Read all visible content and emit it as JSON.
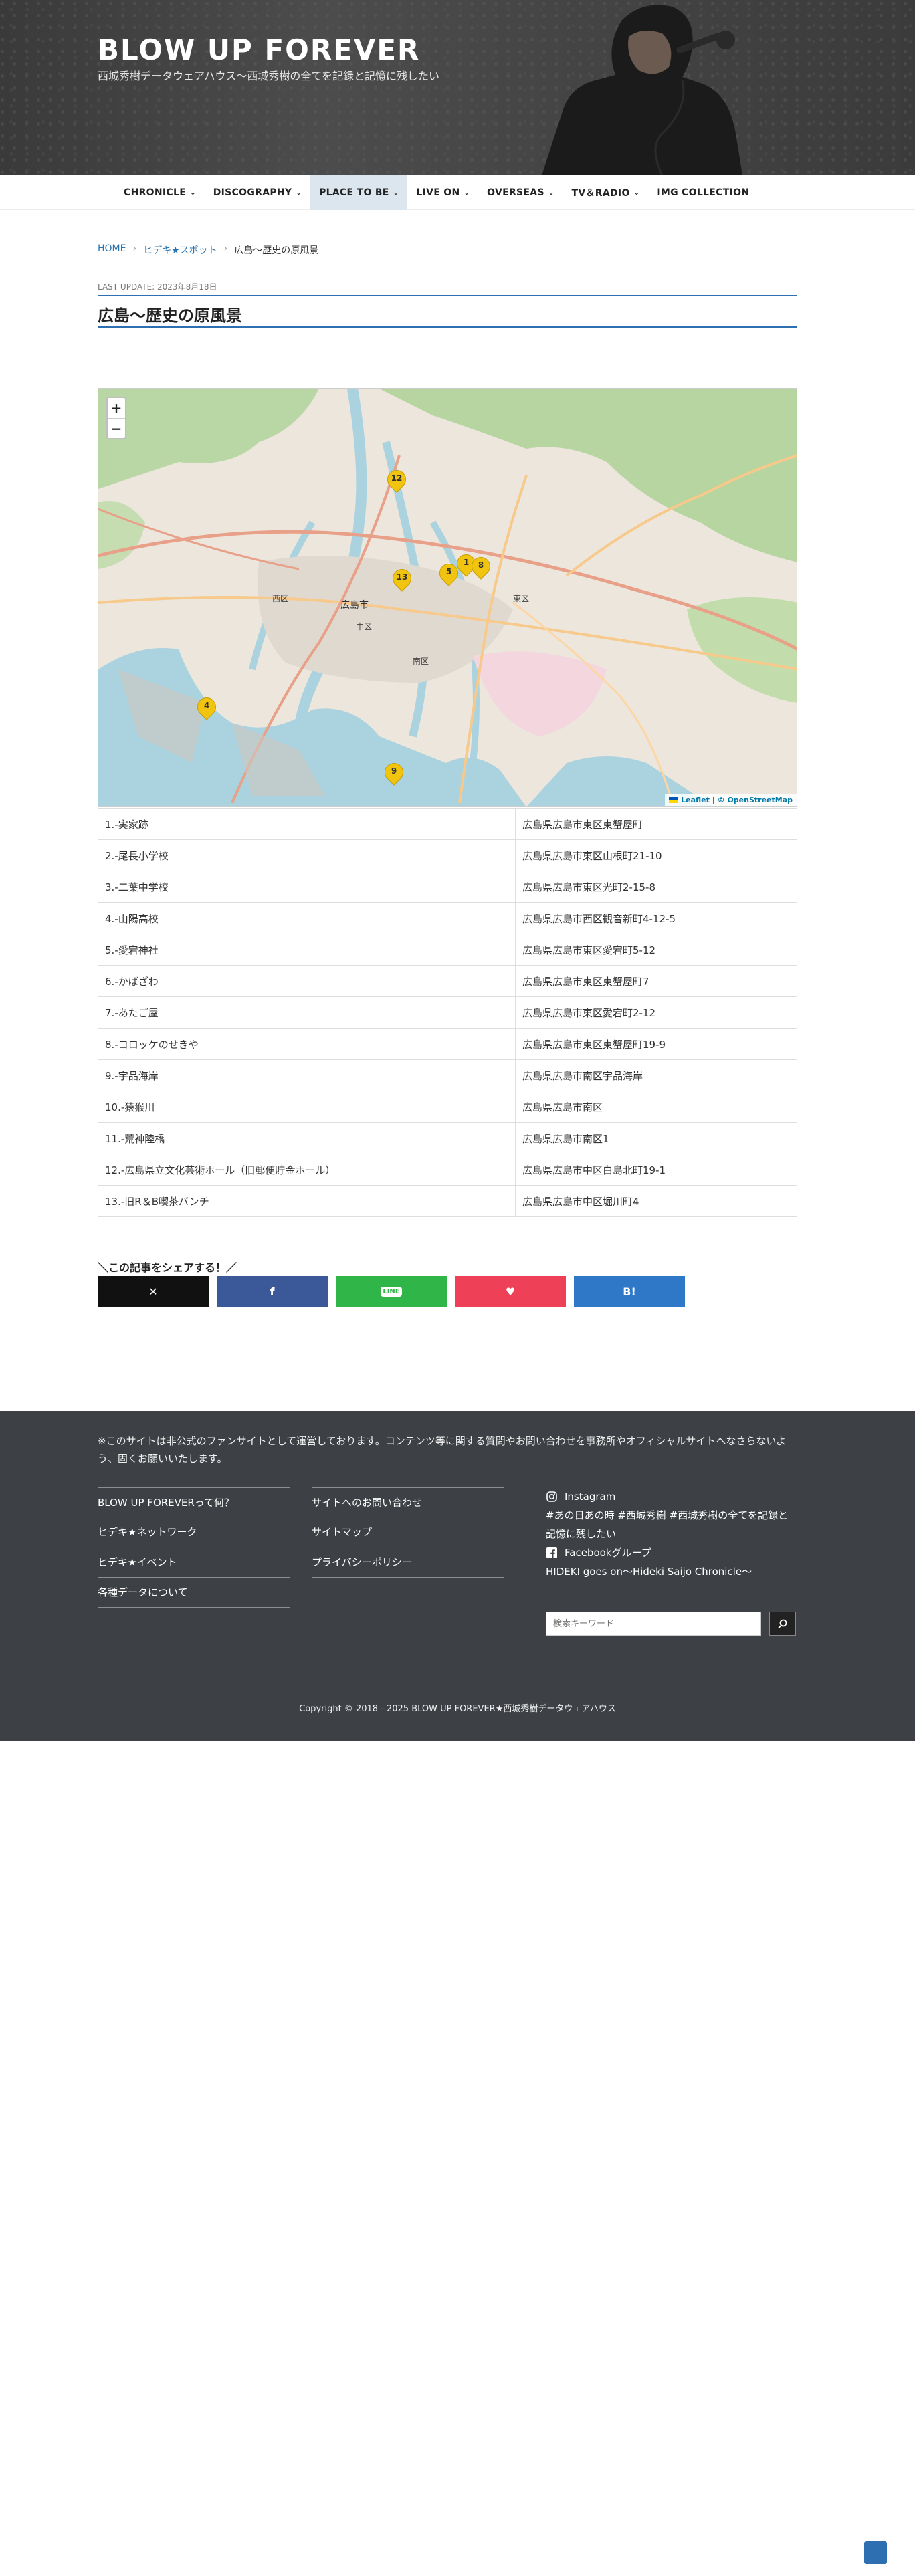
{
  "header": {
    "site_title": "BLOW UP FOREVER",
    "tagline": "西城秀樹データウェアハウス〜西城秀樹の全てを記録と記憶に残したい"
  },
  "nav": {
    "home_icon": "home-icon",
    "items": [
      {
        "label": "CHRONICLE",
        "has_dropdown": true,
        "active": false
      },
      {
        "label": "DISCOGRAPHY",
        "has_dropdown": true,
        "active": false
      },
      {
        "label": "PLACE TO BE",
        "has_dropdown": true,
        "active": true
      },
      {
        "label": "LIVE ON",
        "has_dropdown": true,
        "active": false
      },
      {
        "label": "OVERSEAS",
        "has_dropdown": true,
        "active": false
      },
      {
        "label": "TV＆RADIO",
        "has_dropdown": true,
        "active": false
      },
      {
        "label": "IMG COLLECTION",
        "has_dropdown": false,
        "active": false
      }
    ]
  },
  "breadcrumb": {
    "home": "HOME",
    "category": "ヒデキ★スポット",
    "current": "広島〜歴史の原風景",
    "separator": "›"
  },
  "post": {
    "last_update": "LAST UPDATE: 2023年8月18日",
    "title": "広島〜歴史の原風景"
  },
  "map": {
    "zoom_in": "+",
    "zoom_out": "−",
    "attribution_leaflet": "Leaflet",
    "attribution_sep": "|",
    "attribution_osm": "© OpenStreetMap",
    "place_labels": [
      "広島市",
      "西区",
      "中区",
      "東区",
      "南区"
    ],
    "pins": [
      {
        "number": "12"
      },
      {
        "number": "13"
      },
      {
        "number": "5"
      },
      {
        "number": "1"
      },
      {
        "number": "8"
      },
      {
        "number": "4"
      },
      {
        "number": "9"
      }
    ],
    "accent_color": "#f1c40f"
  },
  "spots": [
    {
      "name": "1.-実家跡",
      "address": "広島県広島市東区東蟹屋町"
    },
    {
      "name": "2.-尾長小学校",
      "address": "広島県広島市東区山根町21-10"
    },
    {
      "name": "3.-二葉中学校",
      "address": "広島県広島市東区光町2-15-8"
    },
    {
      "name": "4.-山陽高校",
      "address": "広島県広島市西区観音新町4-12-5"
    },
    {
      "name": "5.-愛宕神社",
      "address": "広島県広島市東区愛宕町5-12"
    },
    {
      "name": "6.-かばざわ",
      "address": "広島県広島市東区東蟹屋町7"
    },
    {
      "name": "7.-あたご屋",
      "address": "広島県広島市東区愛宕町2-12"
    },
    {
      "name": "8.-コロッケのせきや",
      "address": "広島県広島市東区東蟹屋町19-9"
    },
    {
      "name": "9.-宇品海岸",
      "address": "広島県広島市南区宇品海岸"
    },
    {
      "name": "10.-猿猴川",
      "address": "広島県広島市南区"
    },
    {
      "name": "11.-荒神陸橋",
      "address": "広島県広島市南区1"
    },
    {
      "name": "12.-広島県立文化芸術ホール（旧郵便貯金ホール）",
      "address": "広島県広島市中区白島北町19-1"
    },
    {
      "name": "13.-旧R＆B喫茶バンチ",
      "address": "広島県広島市中区堀川町4"
    }
  ],
  "share": {
    "label": "＼この記事をシェアする！／",
    "buttons": [
      {
        "name": "x",
        "icon": "x-icon",
        "glyph": "✕",
        "color": "#111111"
      },
      {
        "name": "facebook",
        "icon": "facebook-icon",
        "glyph": "f",
        "color": "#3b5998"
      },
      {
        "name": "line",
        "icon": "line-icon",
        "glyph": "LINE",
        "color": "#2fb548"
      },
      {
        "name": "pocket",
        "icon": "pocket-icon",
        "glyph": "♥",
        "color": "#ee4056"
      },
      {
        "name": "hatena",
        "icon": "hatena-icon",
        "glyph": "B!",
        "color": "#2e78c7"
      }
    ]
  },
  "footer": {
    "notice": "※このサイトは非公式のファンサイトとして運営しております。コンテンツ等に関する質問やお問い合わせを事務所やオフィシャルサイトへなさらないよう、固くお願いいたします。",
    "links_col1": [
      "BLOW UP FOREVERって何？",
      "ヒデキ★ネットワーク",
      "ヒデキ★イベント",
      "各種データについて"
    ],
    "links_col2": [
      "サイトへのお問い合わせ",
      "サイトマップ",
      "プライバシーポリシー"
    ],
    "instagram_label": "Instagram",
    "instagram_text": "#あの日あの時 #西城秀樹 #西城秀樹の全てを記録と記憶に残したい",
    "facebook_label": "Facebookグループ",
    "facebook_text": "HIDEKI goes on〜Hideki Saijo Chronicle〜",
    "search_placeholder": "検索キーワード",
    "copyright": "Copyright © 2018 - 2025  BLOW UP FOREVER★西城秀樹データウェアハウス"
  }
}
